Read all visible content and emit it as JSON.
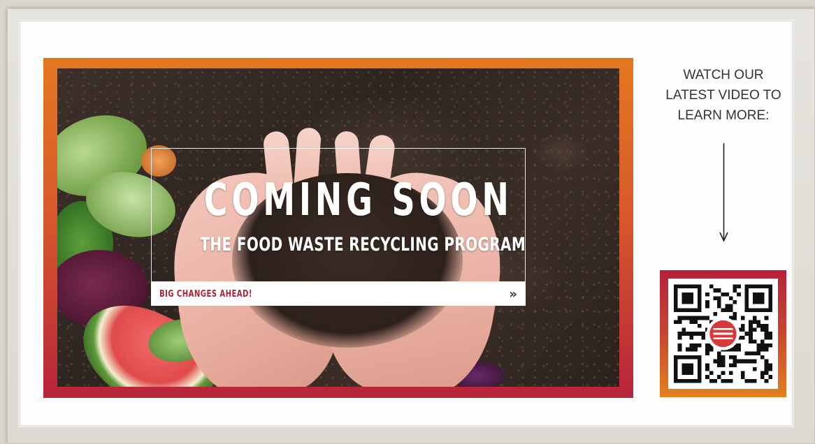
{
  "poster": {
    "title": "COMING SOON",
    "subtitle": "THE FOOD WASTE RECYCLING PROGRAM",
    "banner_text": "BIG CHANGES AHEAD!",
    "banner_arrow": "»",
    "border_colors": [
      "#e4781f",
      "#b8243a"
    ],
    "banner_text_color": "#a8253a"
  },
  "side": {
    "lines": [
      "WATCH OUR",
      "LATEST VIDEO TO",
      "LEARN MORE:"
    ],
    "arrow_icon": "arrow-down-icon",
    "qr_icon": "qr-code-icon"
  }
}
